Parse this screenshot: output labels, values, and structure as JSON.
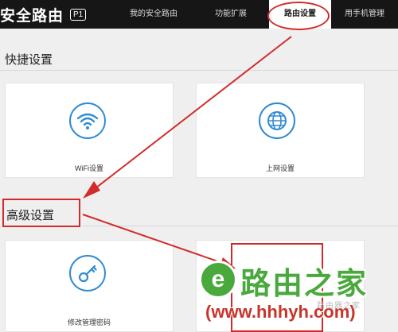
{
  "header": {
    "brand": "安全路由",
    "badge": "P1",
    "nav": [
      {
        "label": "我的安全路由"
      },
      {
        "label": "功能扩展"
      },
      {
        "label": "路由设置"
      },
      {
        "label": "用手机管理"
      }
    ]
  },
  "quick": {
    "title": "快捷设置",
    "cards": [
      {
        "label": "WiFi设置",
        "icon": "wifi-icon"
      },
      {
        "label": "上网设置",
        "icon": "globe-icon"
      }
    ]
  },
  "advanced": {
    "title": "高级设置",
    "cards": [
      {
        "label": "修改管理密码",
        "icon": "key-icon"
      }
    ]
  },
  "watermark": {
    "logo_letter": "e",
    "brand": "路由之家",
    "url": "(www.hhhyh.com)",
    "small": "路由器之家"
  },
  "colors": {
    "topbar": "#161616",
    "accent_blue": "#2f8bd1",
    "annotation_red": "#d22b2b",
    "watermark_green": "#4aa93c"
  }
}
